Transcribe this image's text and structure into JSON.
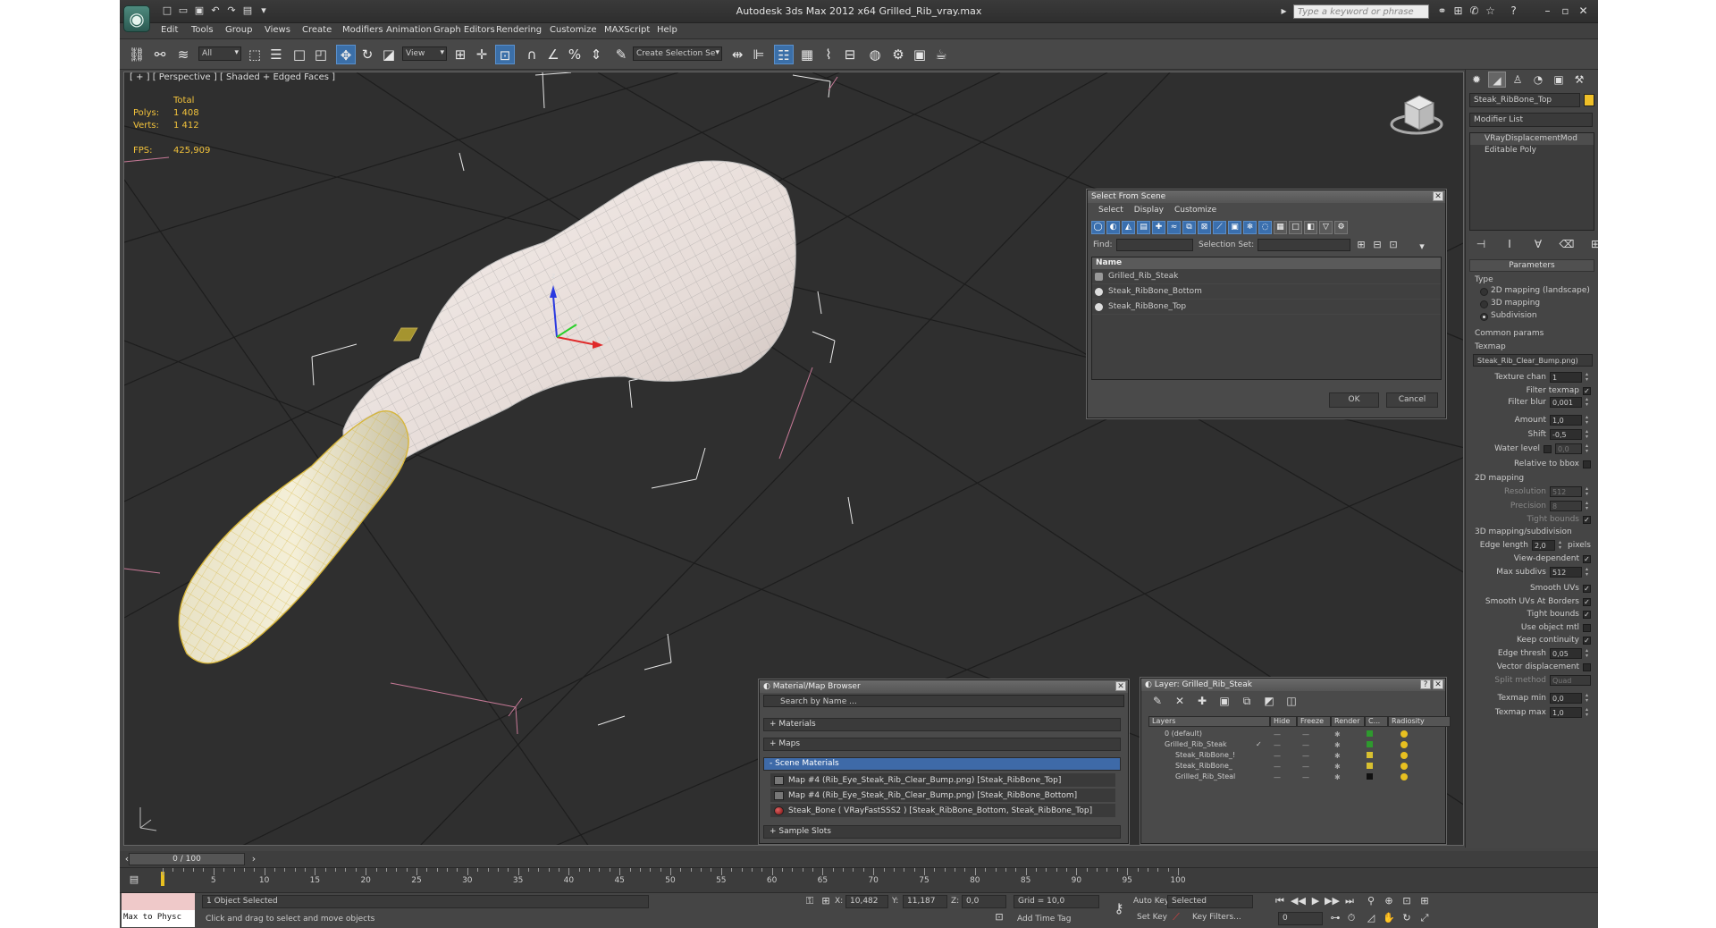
{
  "window": {
    "title": "Autodesk 3ds Max  2012 x64      Grilled_Rib_vray.max",
    "search_placeholder": "Type a keyword or phrase"
  },
  "menu": [
    "Edit",
    "Tools",
    "Group",
    "Views",
    "Create",
    "Modifiers",
    "Animation",
    "Graph Editors",
    "Rendering",
    "Customize",
    "MAXScript",
    "Help"
  ],
  "toolbar": {
    "selection_filter": "All",
    "ref_coord": "View",
    "named_selection": "Create Selection Se"
  },
  "viewport": {
    "label": "[ + ] [ Perspective ] [ Shaded + Edged Faces ]",
    "stats": {
      "header": "Total",
      "polys_label": "Polys:",
      "polys": "1 408",
      "verts_label": "Verts:",
      "verts": "1 412",
      "fps_label": "FPS:",
      "fps": "425,909"
    },
    "axis_x": "x",
    "axis_y": "y",
    "axis_z": "z"
  },
  "command_panel": {
    "object_name": "Steak_RibBone_Top",
    "modifier_list": "Modifier List",
    "stack": [
      "VRayDisplacementMod",
      "Editable Poly"
    ],
    "parameters_header": "Parameters",
    "type_label": "Type",
    "type_options": [
      "2D mapping (landscape)",
      "3D mapping",
      "Subdivision"
    ],
    "type_selected": 2,
    "common_params": "Common params",
    "texmap_label": "Texmap",
    "texmap_value": "Steak_Rib_Clear_Bump.png)",
    "texture_chan_label": "Texture chan",
    "texture_chan": "1",
    "filter_texmap_label": "Filter texmap",
    "filter_blur_label": "Filter blur",
    "filter_blur": "0,001",
    "amount_label": "Amount",
    "amount": "1,0",
    "shift_label": "Shift",
    "shift": "-0,5",
    "water_level_label": "Water level",
    "water_level": "0,0",
    "relative_bbox_label": "Relative to bbox",
    "mapping2d_header": "2D mapping",
    "resolution_label": "Resolution",
    "resolution": "512",
    "precision_label": "Precision",
    "precision": "8",
    "tight_bounds_label": "Tight bounds",
    "mapping3d_header": "3D mapping/subdivision",
    "edge_length_label": "Edge length",
    "edge_length": "2,0",
    "edge_length_unit": "pixels",
    "view_dependent_label": "View-dependent",
    "max_subdivs_label": "Max subdivs",
    "max_subdivs": "512",
    "smooth_uvs_label": "Smooth UVs",
    "smooth_uvs_borders_label": "Smooth UVs At Borders",
    "tight_bounds2_label": "Tight bounds",
    "use_object_mtl_label": "Use object mtl",
    "keep_continuity_label": "Keep continuity",
    "edge_thresh_label": "Edge thresh",
    "edge_thresh": "0,05",
    "vector_disp_label": "Vector displacement",
    "split_method_label": "Split method",
    "split_method": "Quad",
    "texmap_min_label": "Texmap min",
    "texmap_min": "0,0",
    "texmap_max_label": "Texmap max",
    "texmap_max": "1,0"
  },
  "select_dialog": {
    "title": "Select From Scene",
    "menu": [
      "Select",
      "Display",
      "Customize"
    ],
    "find_label": "Find:",
    "selection_set_label": "Selection Set:",
    "column_name": "Name",
    "items": [
      "Grilled_Rib_Steak",
      "Steak_RibBone_Bottom",
      "Steak_RibBone_Top"
    ],
    "ok": "OK",
    "cancel": "Cancel"
  },
  "material_browser": {
    "title": "Material/Map Browser",
    "search": "Search by Name ...",
    "groups": [
      "+ Materials",
      "+ Maps",
      "- Scene Materials",
      "+ Sample Slots"
    ],
    "items": [
      "Map #4 (Rib_Eye_Steak_Rib_Clear_Bump.png) [Steak_RibBone_Top]",
      "Map #4 (Rib_Eye_Steak_Rib_Clear_Bump.png) [Steak_RibBone_Bottom]",
      "Steak_Bone  ( VRayFastSSS2 ) [Steak_RibBone_Bottom, Steak_RibBone_Top]"
    ]
  },
  "layer_dialog": {
    "title": "Layer: Grilled_Rib_Steak",
    "columns": [
      "Layers",
      "Hide",
      "Freeze",
      "Render",
      "C...",
      "Radiosity"
    ],
    "rows": [
      "0 (default)",
      "Grilled_Rib_Steak",
      "Steak_RibBone_!",
      "Steak_RibBone_",
      "Grilled_Rib_Steal"
    ]
  },
  "timeline": {
    "slider": "0 / 100",
    "ticks": [
      "5",
      "10",
      "15",
      "20",
      "25",
      "30",
      "35",
      "40",
      "45",
      "50",
      "55",
      "60",
      "65",
      "70",
      "75",
      "80",
      "85",
      "90",
      "95",
      "100"
    ]
  },
  "status": {
    "maxscript": "Max to Physc",
    "selected": "1 Object Selected",
    "prompt": "Click and drag to select and move objects",
    "x_label": "X:",
    "x": "10,482",
    "y_label": "Y:",
    "y": "11,187",
    "z_label": "Z:",
    "z": "0,0",
    "grid": "Grid = 10,0",
    "add_time_tag": "Add Time Tag",
    "auto_key": "Auto Key",
    "auto_key_mode": "Selected",
    "set_key": "Set Key",
    "key_filters": "Key Filters...",
    "frame": "0"
  },
  "colors": {
    "accent_blue": "#3b6fa8",
    "stats_yellow": "#f3c33b",
    "object_swatch": "#f0c028"
  }
}
